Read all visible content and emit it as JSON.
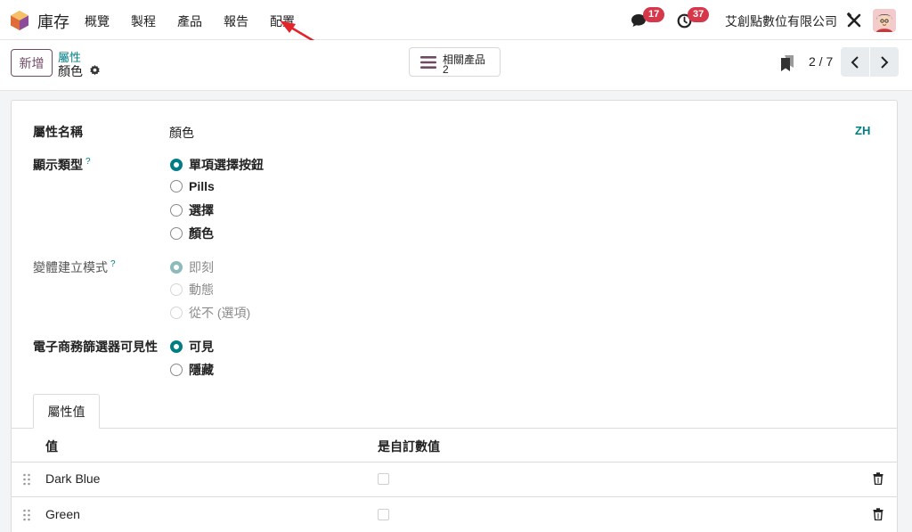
{
  "navbar": {
    "app_name": "庫存",
    "menu": [
      "概覽",
      "製程",
      "產品",
      "報告",
      "配置"
    ],
    "chat_count": "17",
    "activity_count": "37",
    "company": "艾創點數位有限公司"
  },
  "control": {
    "new_label": "新增",
    "breadcrumb_parent": "屬性",
    "breadcrumb_current": "顏色",
    "smart_button_label": "相關產品",
    "smart_button_count": "2",
    "pager": "2 / 7"
  },
  "form": {
    "lang_code": "ZH",
    "attribute_name_label": "屬性名稱",
    "attribute_name_value": "顏色",
    "display_type_label": "顯示類型",
    "display_type_options": [
      "單項選擇按鈕",
      "Pills",
      "選擇",
      "顏色"
    ],
    "variant_mode_label": "變體建立模式",
    "variant_mode_options": [
      "即刻",
      "動態",
      "從不 (選項)"
    ],
    "ecommerce_visibility_label": "電子商務篩選器可見性",
    "ecommerce_visibility_options": [
      "可見",
      "隱藏"
    ],
    "help_marker": "?"
  },
  "notebook": {
    "tab_label": "屬性值",
    "columns": [
      "值",
      "是自訂數值"
    ],
    "rows": [
      {
        "value": "Dark Blue"
      },
      {
        "value": "Green"
      }
    ]
  },
  "colors": {
    "accent": "#017e84",
    "primary": "#6f4a64",
    "badge": "#d6384b",
    "annotation_arrow": "#e3242b"
  }
}
